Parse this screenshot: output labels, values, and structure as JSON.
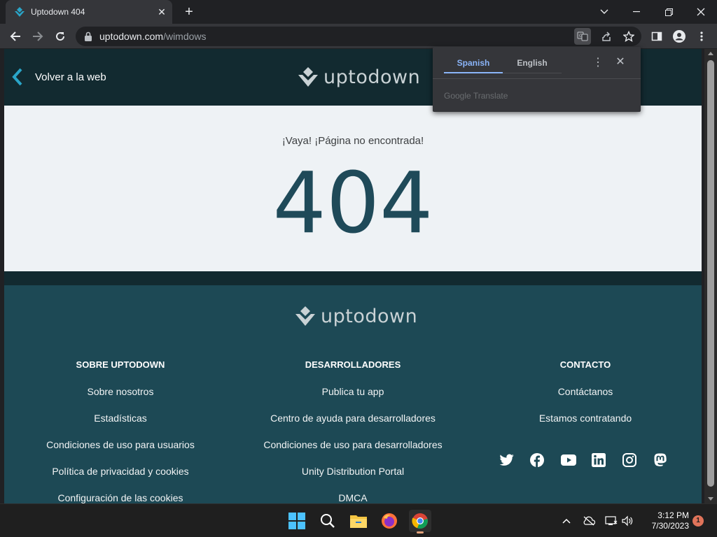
{
  "browser": {
    "tab_title": "Uptodown 404",
    "url_host": "uptodown.com",
    "url_path": "/wimdows"
  },
  "page": {
    "back_label": "Volver a la web",
    "logo_text": "uptodown",
    "error_subtitle": "¡Vaya! ¡Página no encontrada!",
    "error_code": "404"
  },
  "footer": {
    "logo_text": "uptodown",
    "columns": [
      {
        "heading": "SOBRE UPTODOWN",
        "links": [
          "Sobre nosotros",
          "Estadísticas",
          "Condiciones de uso para usuarios",
          "Política de privacidad y cookies",
          "Configuración de las cookies"
        ]
      },
      {
        "heading": "DESARROLLADORES",
        "links": [
          "Publica tu app",
          "Centro de ayuda para desarrolladores",
          "Condiciones de uso para desarrolladores",
          "Unity Distribution Portal",
          "DMCA"
        ]
      },
      {
        "heading": "CONTACTO",
        "links": [
          "Contáctanos",
          "Estamos contratando"
        ]
      }
    ],
    "social_icons": [
      "twitter-icon",
      "facebook-icon",
      "youtube-icon",
      "linkedin-icon",
      "instagram-icon",
      "mastodon-icon"
    ]
  },
  "translate": {
    "source_lang": "Spanish",
    "target_lang": "English",
    "brand": "Google Translate"
  },
  "taskbar": {
    "time": "3:12 PM",
    "date": "7/30/2023",
    "notification_count": "1"
  },
  "colors": {
    "header_bg": "#122a30",
    "footer_bg": "#1d4955",
    "error_code": "#1f4a59",
    "accent": "#2aa5c8",
    "translate_accent": "#8ab4f8"
  }
}
